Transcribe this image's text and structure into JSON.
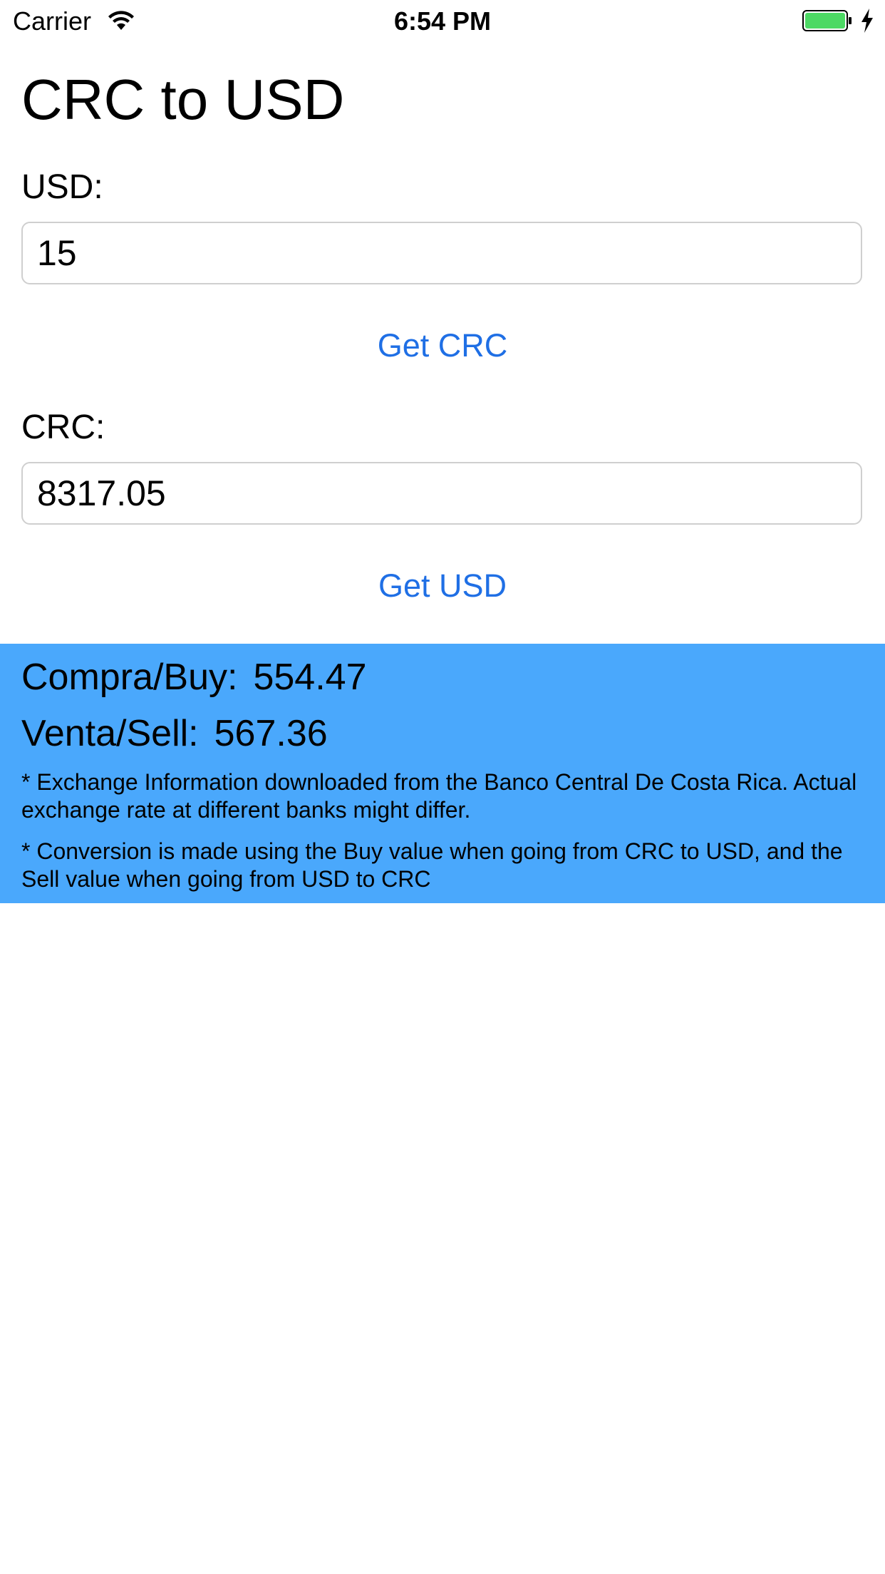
{
  "status_bar": {
    "carrier": "Carrier",
    "time": "6:54 PM",
    "battery_color": "#4cd964"
  },
  "title": "CRC to USD",
  "usd": {
    "label": "USD:",
    "value": "15",
    "button": "Get CRC"
  },
  "crc": {
    "label": "CRC:",
    "value": "8317.05",
    "button": "Get USD"
  },
  "rates": {
    "buy_label": "Compra/Buy:",
    "buy_value": "554.47",
    "sell_label": "Venta/Sell:",
    "sell_value": "567.36"
  },
  "notes": [
    "* Exchange Information downloaded from the Banco Central De Costa Rica. Actual exchange rate at different banks might differ.",
    "* Conversion is made using the Buy value when going from CRC to USD, and the Sell value when going from USD to CRC"
  ],
  "colors": {
    "accent": "#1f6fe5",
    "panel": "#4aa8fc"
  }
}
